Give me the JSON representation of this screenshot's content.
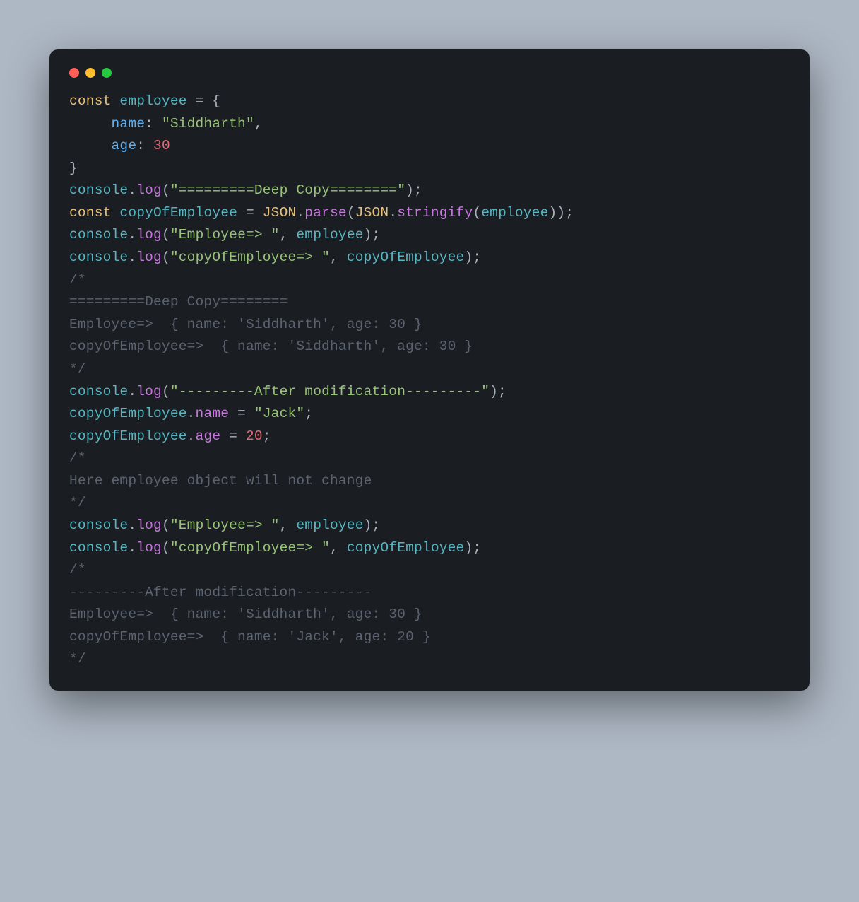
{
  "code": {
    "kw_const1": "const",
    "id_employee": "employee",
    "eq1": " = ",
    "brace_open": "{",
    "indent": "     ",
    "prop_name": "name",
    "colon_sp": ": ",
    "str_sidd": "\"Siddharth\"",
    "comma": ",",
    "prop_age": "age",
    "num_30": "30",
    "brace_close": "}",
    "id_console": "console",
    "dot": ".",
    "fn_log": "log",
    "paren_open": "(",
    "paren_close": ")",
    "semi": ";",
    "str_deep": "\"=========Deep Copy========\"",
    "kw_const2": "const",
    "id_copyemp": "copyOfEmployee",
    "eq2": " = ",
    "cls_json": "JSON",
    "fn_parse": "parse",
    "fn_stringify": "stringify",
    "str_emp": "\"Employee=> \"",
    "comma_sp": ", ",
    "str_copyemp": "\"copyOfEmployee=> \"",
    "cmt1_line1": "/*",
    "cmt1_line2": "=========Deep Copy========",
    "cmt1_line3": "Employee=>  { name: 'Siddharth', age: 30 }",
    "cmt1_line4": "copyOfEmployee=>  { name: 'Siddharth', age: 30 }",
    "cmt1_line5": "*/",
    "str_after": "\"---------After modification---------\"",
    "str_jack": "\"Jack\"",
    "num_20": "20",
    "cmt2_line1": "/*",
    "cmt2_line2": "Here employee object will not change",
    "cmt2_line3": "*/",
    "cmt3_line1": "/*",
    "cmt3_line2": "---------After modification---------",
    "cmt3_line3": "Employee=>  { name: 'Siddharth', age: 30 }",
    "cmt3_line4": "copyOfEmployee=>  { name: 'Jack', age: 20 }",
    "cmt3_line5": "*/"
  }
}
